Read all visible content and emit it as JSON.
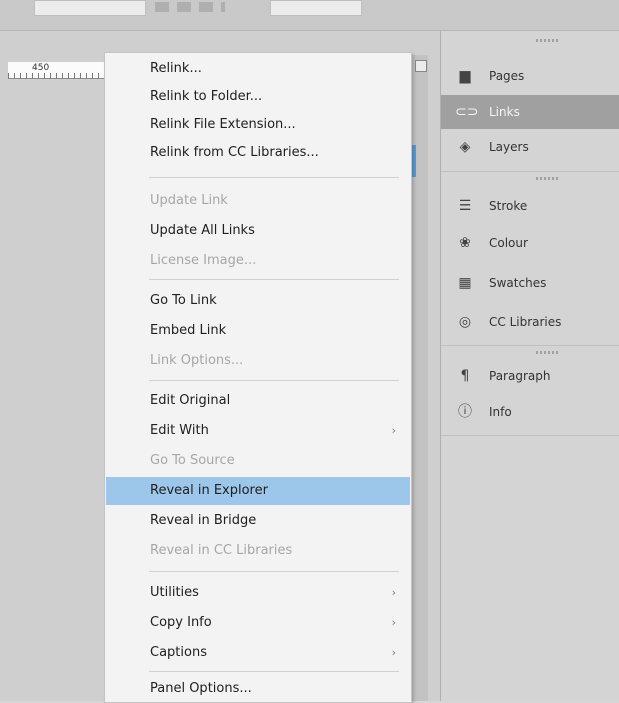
{
  "ruler": {
    "label": "450"
  },
  "menu": {
    "items": [
      {
        "label": "Relink...",
        "enabled": true
      },
      {
        "label": "Relink to Folder...",
        "enabled": true
      },
      {
        "label": "Relink File Extension...",
        "enabled": true
      },
      {
        "label": "Relink from CC Libraries...",
        "enabled": true
      },
      {
        "label": "Update Link",
        "enabled": false
      },
      {
        "label": "Update All Links",
        "enabled": true
      },
      {
        "label": "License Image...",
        "enabled": false
      },
      {
        "label": "Go To Link",
        "enabled": true
      },
      {
        "label": "Embed Link",
        "enabled": true
      },
      {
        "label": "Link Options...",
        "enabled": false
      },
      {
        "label": "Edit Original",
        "enabled": true
      },
      {
        "label": "Edit With",
        "enabled": true,
        "submenu": true
      },
      {
        "label": "Go To Source",
        "enabled": false
      },
      {
        "label": "Reveal in Explorer",
        "enabled": true,
        "highlighted": true
      },
      {
        "label": "Reveal in Bridge",
        "enabled": true
      },
      {
        "label": "Reveal in CC Libraries",
        "enabled": false
      },
      {
        "label": "Utilities",
        "enabled": true,
        "submenu": true
      },
      {
        "label": "Copy Info",
        "enabled": true,
        "submenu": true
      },
      {
        "label": "Captions",
        "enabled": true,
        "submenu": true
      },
      {
        "label": "Panel Options...",
        "enabled": true
      }
    ],
    "submenu_arrow": "›",
    "highlight_color": "#9cc7ea"
  },
  "panels": {
    "items": [
      {
        "label": "Pages",
        "icon": "pages-icon",
        "glyph": "▆"
      },
      {
        "label": "Links",
        "icon": "links-icon",
        "glyph": "⊂⊃",
        "active": true
      },
      {
        "label": "Layers",
        "icon": "layers-icon",
        "glyph": "◈"
      },
      {
        "label": "Stroke",
        "icon": "stroke-icon",
        "glyph": "☰"
      },
      {
        "label": "Colour",
        "icon": "colour-icon",
        "glyph": "❀"
      },
      {
        "label": "Swatches",
        "icon": "swatches-icon",
        "glyph": "▦"
      },
      {
        "label": "CC Libraries",
        "icon": "cc-libraries-icon",
        "glyph": "◎"
      },
      {
        "label": "Paragraph",
        "icon": "paragraph-icon",
        "glyph": "¶"
      },
      {
        "label": "Info",
        "icon": "info-icon",
        "glyph": "ⓘ"
      }
    ],
    "active_color": "#a0a0a0"
  }
}
